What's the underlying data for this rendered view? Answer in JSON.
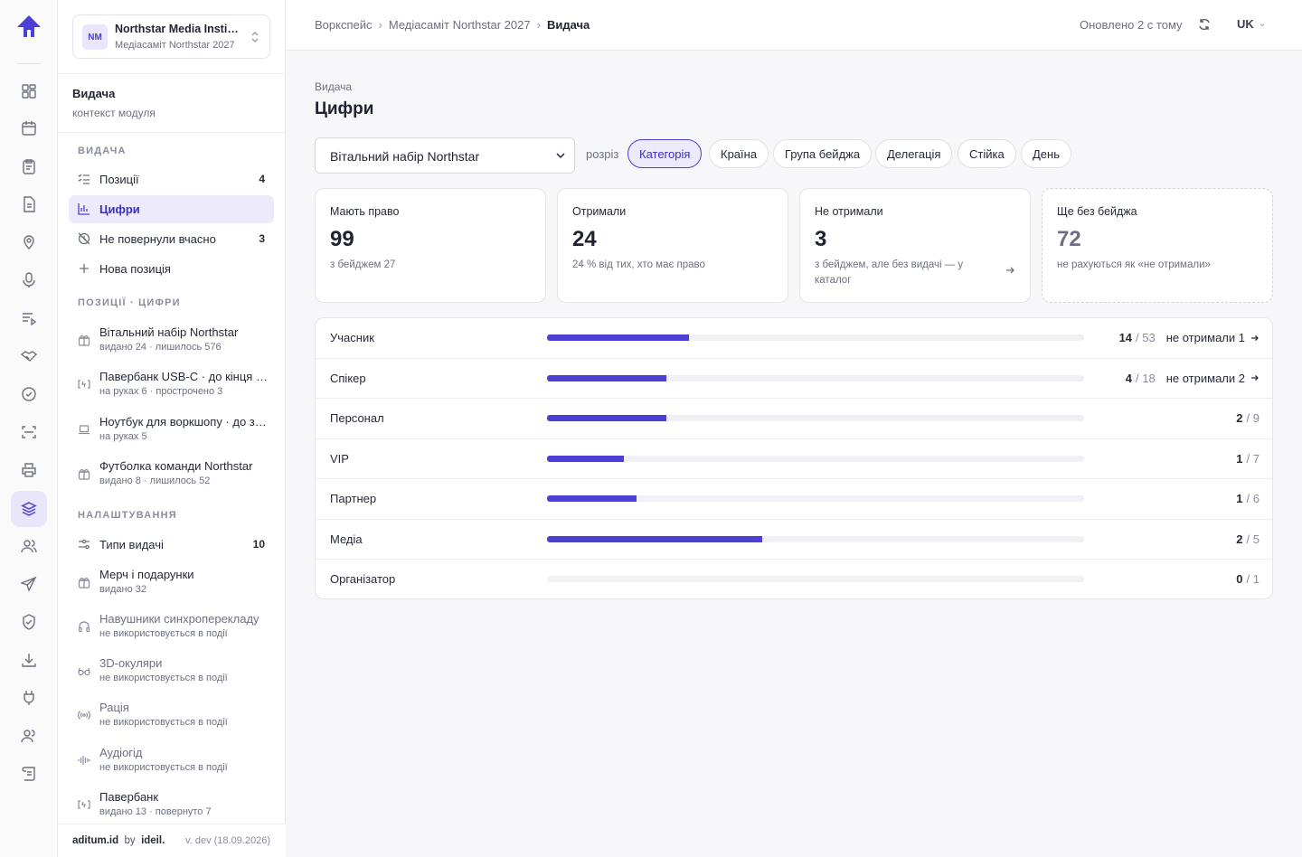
{
  "org": {
    "name": "Northstar Media Institute",
    "event": "Медіасаміт Northstar 2027",
    "initials": "NM"
  },
  "context": {
    "title": "Видача",
    "subtitle": "контекст модуля"
  },
  "sections": {
    "issue": "ВИДАЧА",
    "positions": "ПОЗИЦІЇ · ЦИФРИ",
    "settings": "НАЛАШТУВАННЯ"
  },
  "nav": [
    {
      "label": "Позиції",
      "count": "4",
      "icon": "checklist-icon"
    },
    {
      "label": "Цифри",
      "count": "",
      "icon": "bar-chart-icon"
    },
    {
      "label": "Не повернули вчасно",
      "count": "3",
      "icon": "clock-off-icon"
    },
    {
      "label": "Нова позиція",
      "count": "",
      "icon": "plus-icon"
    }
  ],
  "positions": [
    {
      "title": "Вітальний набір Northstar",
      "meta": "видано 24 · лишилось 576",
      "icon": "gift-icon"
    },
    {
      "title": "Павербанк USB-C · до кінця дня",
      "meta": "на руках 6 · прострочено 3",
      "icon": "battery-icon"
    },
    {
      "title": "Ноутбук для воркшопу · до завершення",
      "meta": "на руках 5",
      "icon": "laptop-icon"
    },
    {
      "title": "Футболка команди Northstar",
      "meta": "видано 8 · лишилось 52",
      "icon": "gift-icon"
    }
  ],
  "settings_nav": {
    "label": "Типи видачі",
    "count": "10"
  },
  "settings_items": [
    {
      "title": "Мерч і подарунки",
      "meta": "видано 32",
      "icon": "gift-icon",
      "muted": false
    },
    {
      "title": "Навушники синхроперекладу",
      "meta": "не використовується в події",
      "icon": "headphones-icon",
      "muted": true
    },
    {
      "title": "3D-окуляри",
      "meta": "не використовується в події",
      "icon": "glasses-icon",
      "muted": true
    },
    {
      "title": "Рація",
      "meta": "не використовується в події",
      "icon": "radio-icon",
      "muted": true
    },
    {
      "title": "Аудіогід",
      "meta": "не використовується в події",
      "icon": "audio-wave-icon",
      "muted": true
    },
    {
      "title": "Павербанк",
      "meta": "видано 13 · повернуто 7",
      "icon": "battery-icon",
      "muted": false
    }
  ],
  "footer": {
    "brand": "aditum.id",
    "by": "by",
    "partner": "ideil.",
    "version": "v. dev (18.09.2026)"
  },
  "breadcrumbs": [
    "Воркспейс",
    "Медіасаміт Northstar 2027",
    "Видача"
  ],
  "topbar": {
    "updated": "Оновлено 2 с тому",
    "lang": "UK"
  },
  "page": {
    "pre_title": "Видача",
    "title": "Цифри"
  },
  "filter": {
    "selected": "Вітальний набір Northstar",
    "rozriz": "розріз"
  },
  "chips": [
    "Категорія",
    "Країна",
    "Група бейджа",
    "Делегація",
    "Стійка",
    "День"
  ],
  "active_chip": "Категорія",
  "cards": [
    {
      "label": "Мають право",
      "value": "99",
      "note": "з бейджем 27"
    },
    {
      "label": "Отримали",
      "value": "24",
      "note": "24 % від тих, хто має право"
    },
    {
      "label": "Не отримали",
      "value": "3",
      "note": "з бейджем, але без видачі — у каталог"
    },
    {
      "label": "Ще без бейджа",
      "value": "72",
      "note": "не рахуються як «не отримали»"
    }
  ],
  "chart_data": {
    "type": "bar",
    "categories": [
      "Учасник",
      "Спікер",
      "Персонал",
      "VIP",
      "Партнер",
      "Медіа",
      "Організатор"
    ],
    "series": [
      {
        "values": [
          14,
          4,
          2,
          1,
          1,
          2,
          0
        ]
      },
      {
        "values": [
          53,
          18,
          9,
          7,
          6,
          5,
          1
        ]
      }
    ],
    "not_received": [
      "не отримали 1",
      "не отримали 2",
      "",
      "",
      "",
      "",
      ""
    ]
  },
  "colors": {
    "accent": "#4b3fd6",
    "accent_bg": "#eceafb"
  }
}
